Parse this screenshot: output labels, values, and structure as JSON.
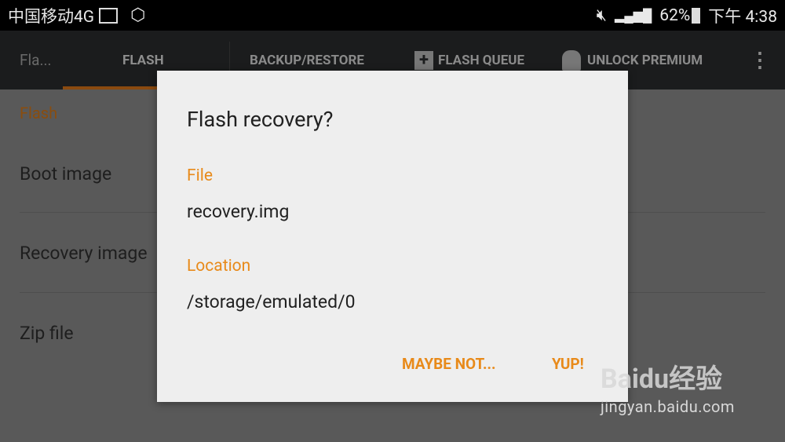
{
  "status_bar": {
    "carrier": "中国移动4G",
    "battery": "62%",
    "time": "下午 4:38",
    "icons": [
      "image-icon",
      "settings-icon",
      "mute-icon",
      "signal-icon",
      "battery-icon"
    ]
  },
  "app_bar": {
    "title": "Fla...",
    "tabs": [
      "FLASH",
      "BACKUP/RESTORE",
      "FLASH QUEUE",
      "UNLOCK PREMIUM"
    ],
    "active_tab": "FLASH",
    "accent": "#e88a1a"
  },
  "list": {
    "section": "Flash",
    "items": [
      "Boot image",
      "Recovery image",
      "Zip file"
    ]
  },
  "dialog": {
    "title": "Flash recovery?",
    "file_label": "File",
    "file_value": "recovery.img",
    "location_label": "Location",
    "location_value": "/storage/emulated/0",
    "cancel": "MAYBE NOT...",
    "confirm": "YUP!"
  },
  "watermark": {
    "brand": "Baidu经验",
    "url": "jingyan.baidu.com"
  }
}
